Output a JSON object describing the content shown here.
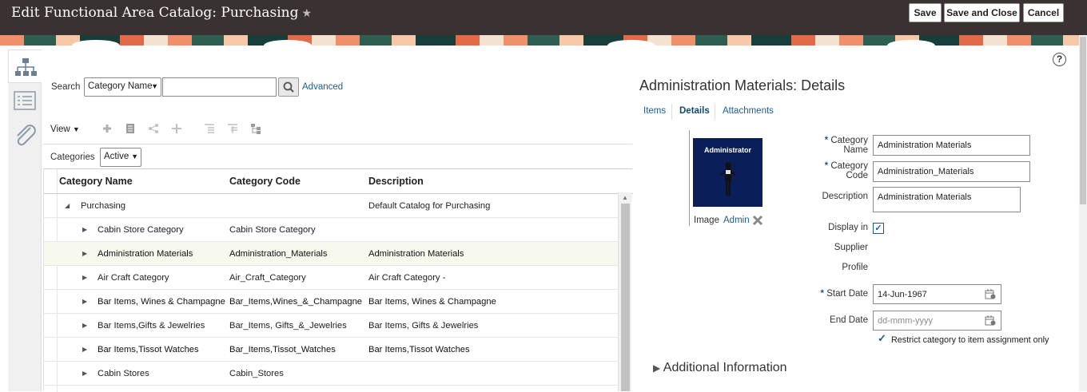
{
  "header": {
    "title": "Edit Functional Area Catalog: Purchasing",
    "star": "★",
    "save": "Save",
    "save_and_close": "Save and Close",
    "cancel": "Cancel"
  },
  "left_tabs": [
    "hierarchy-icon",
    "list-icon",
    "attachment-icon"
  ],
  "help": "?",
  "search": {
    "label": "Search",
    "field": "Category Name",
    "value": "",
    "advanced": "Advanced"
  },
  "toolbar": {
    "view": "View",
    "icons": [
      "add-icon",
      "edit-icon",
      "share-icon",
      "move-icon",
      "align-left-icon",
      "align-top-icon",
      "hierarchy-view-icon"
    ]
  },
  "filter": {
    "label": "Categories",
    "value": "Active"
  },
  "table": {
    "headers": [
      "Category Name",
      "Category Code",
      "Description"
    ],
    "rows": [
      {
        "expand": "◢",
        "name": "Purchasing",
        "code": "",
        "desc": "Default Catalog for Purchasing",
        "bold": false,
        "sel": false,
        "indent": 0
      },
      {
        "expand": "▶",
        "name": "Cabin Store Category",
        "code": "Cabin Store Category",
        "desc": "",
        "bold": false,
        "sel": false,
        "indent": 1
      },
      {
        "expand": "▶",
        "name": "Administration Materials",
        "code": "Administration_Materials",
        "desc": "Administration Materials",
        "bold": true,
        "sel": true,
        "indent": 1
      },
      {
        "expand": "▶",
        "name": "Air Craft Category",
        "code": "Air_Craft_Category",
        "desc": "Air Craft Category -",
        "bold": false,
        "sel": false,
        "indent": 1
      },
      {
        "expand": "▶",
        "name": "Bar Items, Wines & Champagne",
        "code": "Bar_Items,Wines_&_Champagne",
        "desc": "Bar Items, Wines & Champagne",
        "bold": true,
        "sel": false,
        "indent": 1
      },
      {
        "expand": "▶",
        "name": "Bar Items,Gifts & Jewelries",
        "code": "Bar_Items, Gifts_&_Jewelries",
        "desc": "Bar Items, Gifts & Jewelries",
        "bold": false,
        "sel": false,
        "indent": 1
      },
      {
        "expand": "▶",
        "name": "Bar Items,Tissot Watches",
        "code": "Bar_Items,Tissot_Watches",
        "desc": "Bar Items,Tissot Watches",
        "bold": true,
        "sel": false,
        "indent": 1
      },
      {
        "expand": "▶",
        "name": "Cabin Stores",
        "code": "Cabin_Stores",
        "desc": "",
        "bold": false,
        "sel": false,
        "indent": 1
      }
    ]
  },
  "detail": {
    "title": "Administration Materials: Details",
    "tabs": [
      "Items",
      "Details",
      "Attachments"
    ],
    "active_tab": "Details",
    "image_caption": "Administrator",
    "image_label": "Image",
    "image_link": "Admin",
    "category_name_label1": "Category",
    "category_name_label2": "Name",
    "category_name": "Administration Materials",
    "category_code_label1": "Category",
    "category_code_label2": "Code",
    "category_code": "Administration_Materials",
    "description_label": "Description",
    "description": "Administration Materials",
    "display_label1": "Display in",
    "display_label2": "Supplier",
    "display_label3": "Profile",
    "display_checked": "✓",
    "start_date_label": "Start Date",
    "start_date": "14-Jun-1967",
    "end_date_label": "End Date",
    "end_date_placeholder": "dd-mmm-yyyy",
    "restrict_check": "✓",
    "restrict_label": "Restrict category to item assignment only",
    "additional": "Additional Information",
    "required_mark": "*"
  }
}
